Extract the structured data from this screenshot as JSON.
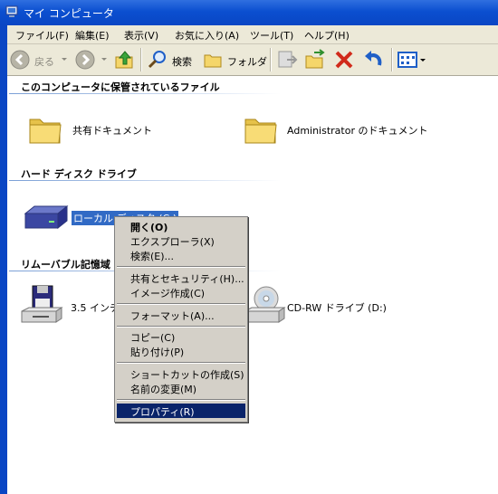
{
  "window": {
    "title": "マイ コンピュータ"
  },
  "menubar": [
    "ファイル(F)",
    "編集(E)",
    "表示(V)",
    "お気に入り(A)",
    "ツール(T)",
    "ヘルプ(H)"
  ],
  "toolbar": {
    "back": "戻る",
    "search": "検索",
    "folders": "フォルダ"
  },
  "groups": {
    "files": "このコンピュータに保管されているファイル",
    "hdd": "ハード ディスク ドライブ",
    "removable": "リムーバブル記憶域"
  },
  "items": {
    "shared_docs": "共有ドキュメント",
    "admin_docs": "Administrator のドキュメント",
    "local_disk": "ローカル ディスク (C:)",
    "floppy": "3.5 インチ",
    "cdrw": "CD-RW ドライブ (D:)"
  },
  "context_menu": {
    "open": "開く(O)",
    "explorer": "エクスプローラ(X)",
    "search": "検索(E)...",
    "sharing": "共有とセキュリティ(H)...",
    "image": "イメージ作成(C)",
    "format": "フォーマット(A)...",
    "copy": "コピー(C)",
    "paste": "貼り付け(P)",
    "shortcut": "ショートカットの作成(S)",
    "rename": "名前の変更(M)",
    "properties": "プロパティ(R)"
  },
  "colors": {
    "titlebar": "#0a46c4",
    "selection": "#0a246a",
    "folder": "#f5d66a",
    "close_x": "#d12a1b"
  }
}
